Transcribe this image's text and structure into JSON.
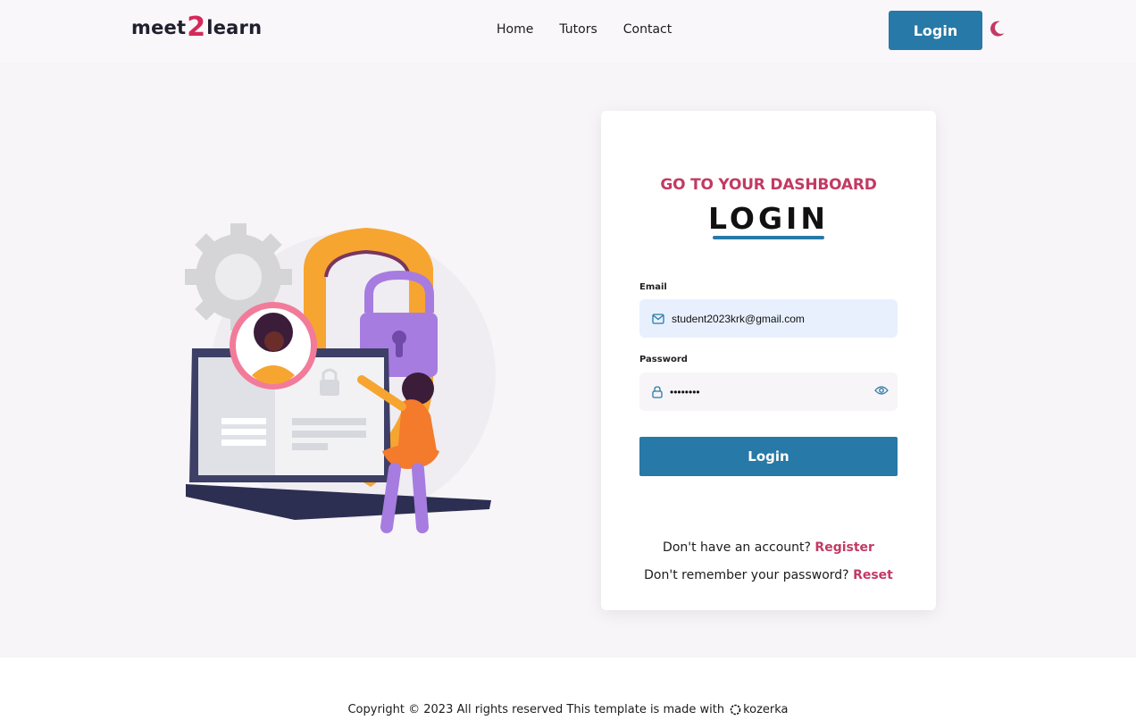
{
  "header": {
    "logo_left": "meet",
    "logo_mid": "2",
    "logo_right": "learn",
    "nav": [
      "Home",
      "Tutors",
      "Contact"
    ],
    "login_label": "Login",
    "theme_icon": "moon-icon"
  },
  "card": {
    "subtitle": "GO TO YOUR DASHBOARD",
    "title": "LOGIN",
    "email_label": "Email",
    "email_value": "student2023krk@gmail.com",
    "email_icon": "mail-icon",
    "password_label": "Password",
    "password_value": "••••••••",
    "password_icon": "lock-icon",
    "reveal_icon": "eye-icon",
    "submit_label": "Login",
    "register_prompt": "Don't have an account?",
    "register_link": "Register",
    "reset_prompt": "Don't remember your password?",
    "reset_link": "Reset"
  },
  "footer": {
    "copyright": "Copyright © 2023 All rights reserved This template is made with",
    "brand": "kozerka"
  },
  "colors": {
    "primary": "#2779a7",
    "accent": "#c23a64",
    "logo_accent": "#d4295a"
  }
}
